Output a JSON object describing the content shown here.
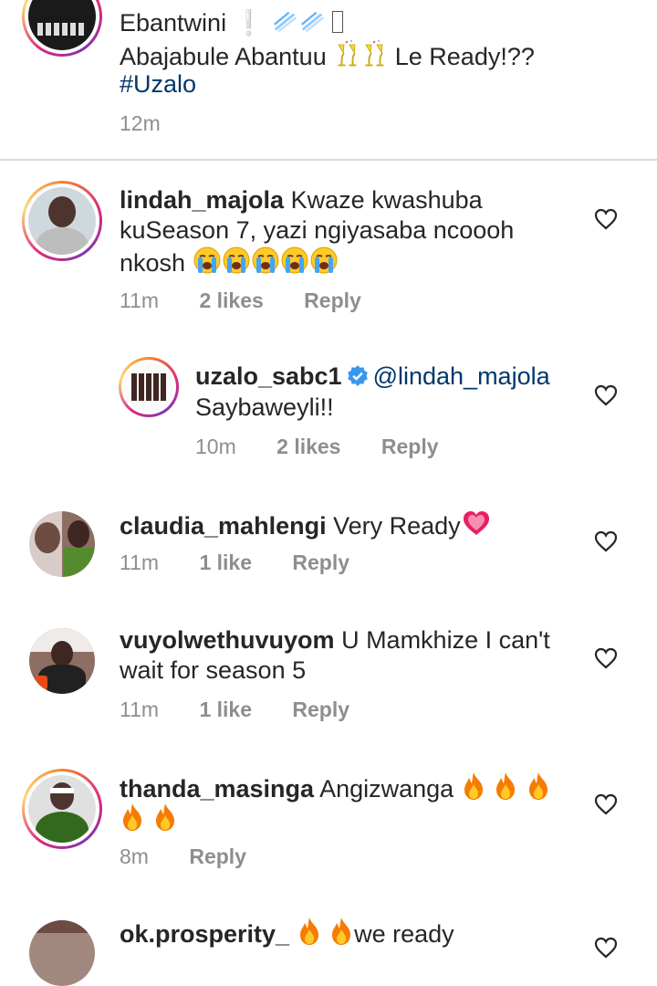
{
  "top_comment": {
    "line1": "Ebantwini",
    "line2": "Abajabule Abantuu",
    "line2_tail": "Le Ready!??",
    "hashtag": "#Uzalo",
    "time": "12m"
  },
  "comments": [
    {
      "username": "lindah_majola",
      "text_line1": "Kwaze kwashuba",
      "text_line2": "kuSeason 7, yazi ngiyasaba ncoooh",
      "text_line3": "nkosh",
      "time": "11m",
      "likes": "2 likes",
      "reply": "Reply"
    },
    {
      "username": "uzalo_sabc1",
      "mention": "@lindah_majola",
      "text_line2": "Saybaweyli!!",
      "time": "10m",
      "likes": "2 likes",
      "reply": "Reply"
    },
    {
      "username": "claudia_mahlengi",
      "text_line1": "Very Ready",
      "time": "11m",
      "likes": "1 like",
      "reply": "Reply"
    },
    {
      "username": "vuyolwethuvuyom",
      "text_line1": "U Mamkhize I can't",
      "text_line2": "wait for season 5",
      "time": "11m",
      "likes": "1 like",
      "reply": "Reply"
    },
    {
      "username": "thanda_masinga",
      "text_line1": "Angizwanga",
      "time": "8m",
      "reply": "Reply"
    },
    {
      "username": "ok.prosperity_",
      "text_line1": "we ready"
    }
  ],
  "colors": {
    "text": "#262626",
    "meta": "#8e8e8e",
    "hashtag": "#00376b",
    "verified": "#3897f0"
  }
}
